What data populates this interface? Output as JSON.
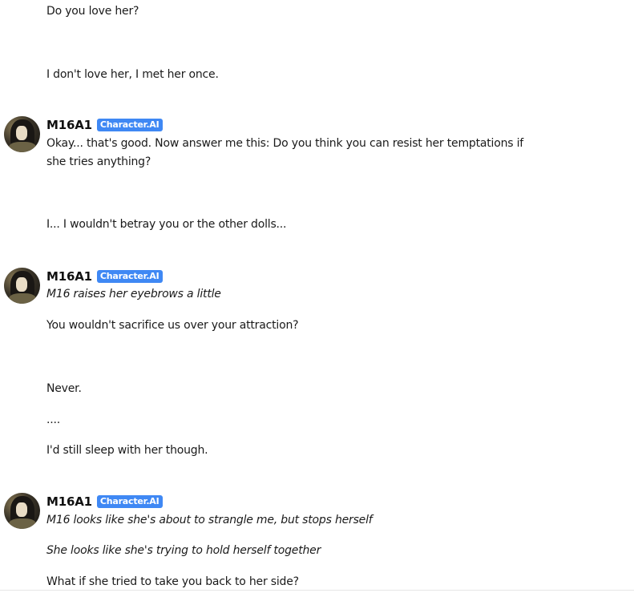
{
  "messages": {
    "user_1": "Do you love her?",
    "user_2": "I don't love her, I met her once.",
    "bot_1": {
      "name": "M16A1",
      "badge": "Character.AI",
      "text": "Okay... that's good. Now answer me this: Do you think you can resist her temptations if she tries anything?"
    },
    "user_3": "I... I wouldn't betray you or the other dolls...",
    "bot_2": {
      "name": "M16A1",
      "badge": "Character.AI",
      "action": "M16 raises her eyebrows a little",
      "text": "You wouldn't sacrifice us over your attraction?"
    },
    "user_4": {
      "line1": "Never.",
      "line2": "....",
      "line3": "I'd still sleep with her though."
    },
    "bot_3": {
      "name": "M16A1",
      "badge": "Character.AI",
      "action1": "M16 looks like she's about to strangle me, but stops herself",
      "action2": "She looks like she's trying to hold herself together",
      "text": "What if she tried to take you back to her side?"
    }
  }
}
